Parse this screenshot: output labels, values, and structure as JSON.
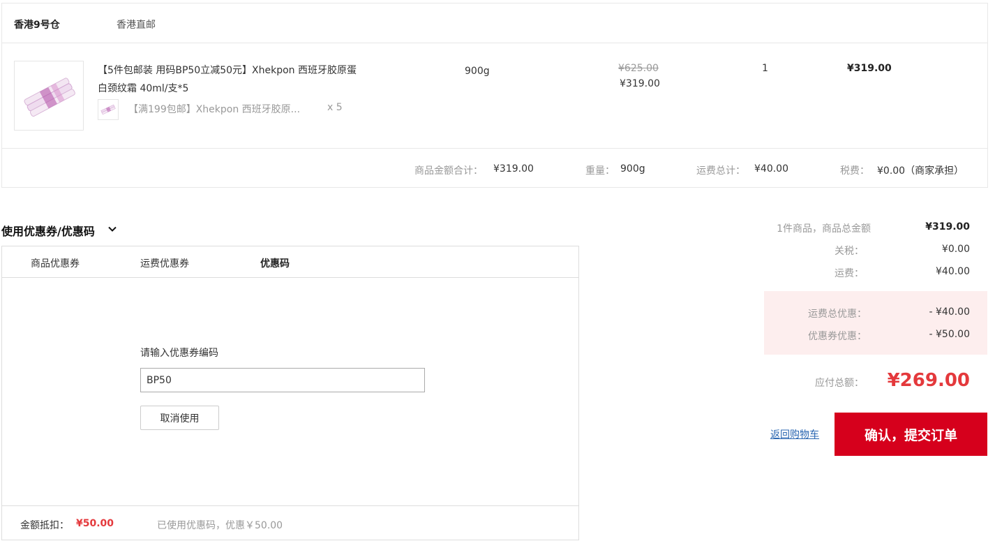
{
  "warehouse": {
    "name": "香港9号仓",
    "shipping": "香港直邮"
  },
  "item": {
    "title": "【5件包邮装 用码BP50立减50元】Xhekpon 西班牙胶原蛋白颈纹霜 40ml/支*5",
    "sub_name": "【满199包邮】Xhekpon 西班牙胶原...",
    "sub_qty": "x 5",
    "spec": "900g",
    "original_price": "¥625.00",
    "price": "¥319.00",
    "quantity": "1",
    "subtotal": "¥319.00"
  },
  "order_summary": {
    "goods_total_label": "商品金额合计：",
    "goods_total": "¥319.00",
    "weight_label": "重量：",
    "weight": "900g",
    "shipping_label": "运费总计：",
    "shipping": "¥40.00",
    "tax_label": "税费：",
    "tax": "¥0.00（商家承担）"
  },
  "coupon": {
    "heading": "使用优惠券/优惠码",
    "tabs": [
      {
        "label": "商品优惠券",
        "active": false
      },
      {
        "label": "运费优惠券",
        "active": false
      },
      {
        "label": "优惠码",
        "active": true
      }
    ],
    "code_label": "请输入优惠券编码",
    "code_value": "BP50",
    "cancel_label": "取消使用",
    "deduction_label": "金额抵扣：",
    "deduction_amount": "¥50.00",
    "deduction_note": "已使用优惠码，优惠￥50.00"
  },
  "totals": {
    "items_label": "1件商品，商品总金额",
    "items_total": "¥319.00",
    "duty_label": "关税：",
    "duty": "¥0.00",
    "freight_label": "运费：",
    "freight": "¥40.00",
    "freight_discount_label": "运费总优惠：",
    "freight_discount": "- ¥40.00",
    "coupon_discount_label": "优惠券优惠：",
    "coupon_discount": "- ¥50.00",
    "payable_label": "应付总额：",
    "payable": "¥269.00"
  },
  "actions": {
    "back_label": "返回购物车",
    "submit_label": "确认，提交订单"
  },
  "colors": {
    "accent": "#e4393c",
    "submit_bg": "#d6001c",
    "link": "#2a66b1",
    "discount_bg": "#fdeeee"
  },
  "icons": {
    "coupon_toggle": "chevron-down-icon"
  }
}
